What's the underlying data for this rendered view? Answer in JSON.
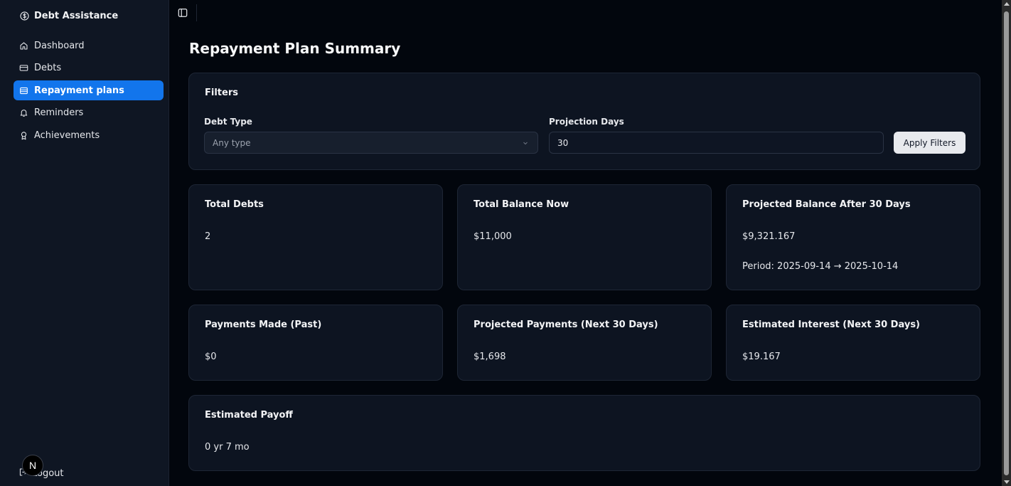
{
  "sidebar": {
    "brand": "Debt Assistance",
    "items": [
      {
        "label": "Dashboard",
        "icon": "home-icon"
      },
      {
        "label": "Debts",
        "icon": "credit-card-icon"
      },
      {
        "label": "Repayment plans",
        "icon": "wallet-icon",
        "active": true
      },
      {
        "label": "Reminders",
        "icon": "bell-icon"
      },
      {
        "label": "Achievements",
        "icon": "award-icon"
      }
    ],
    "logout_label": "Logout",
    "badge_letter": "N"
  },
  "main": {
    "title": "Repayment Plan Summary",
    "filters": {
      "title": "Filters",
      "debt_type_label": "Debt Type",
      "debt_type_placeholder": "Any type",
      "projection_days_label": "Projection Days",
      "projection_days_value": "30",
      "apply_label": "Apply Filters"
    },
    "cards": {
      "total_debts": {
        "title": "Total Debts",
        "value": "2"
      },
      "total_balance": {
        "title": "Total Balance Now",
        "value": "$11,000"
      },
      "projected_balance": {
        "title": "Projected Balance After 30 Days",
        "value": "$9,321.167",
        "period": "Period: 2025-09-14 → 2025-10-14"
      },
      "payments_made": {
        "title": "Payments Made (Past)",
        "value": "$0"
      },
      "projected_payments": {
        "title": "Projected Payments (Next 30 Days)",
        "value": "$1,698"
      },
      "estimated_interest": {
        "title": "Estimated Interest (Next 30 Days)",
        "value": "$19.167"
      },
      "estimated_payoff": {
        "title": "Estimated Payoff",
        "value": "0 yr 7 mo"
      }
    }
  },
  "colors": {
    "accent": "#1275ec",
    "sidebar_bg": "#0f1623",
    "main_bg": "#02060d",
    "card_bg": "#0d1421"
  }
}
